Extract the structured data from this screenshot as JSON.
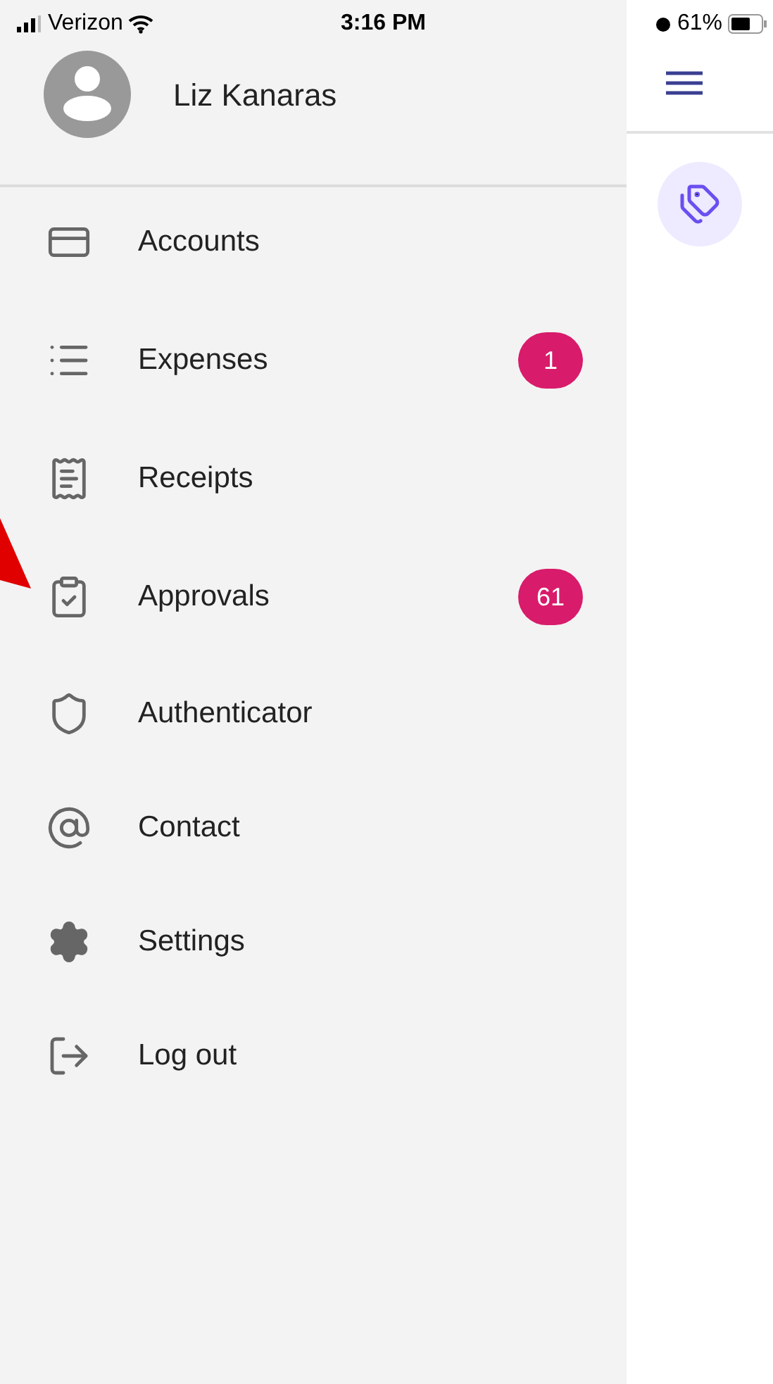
{
  "status_bar": {
    "carrier": "Verizon",
    "time": "3:16 PM",
    "battery": "61%"
  },
  "user": {
    "name": "Liz Kanaras"
  },
  "menu": [
    {
      "label": "Accounts"
    },
    {
      "label": "Expenses",
      "badge": "1"
    },
    {
      "label": "Receipts"
    },
    {
      "label": "Approvals",
      "badge": "61"
    },
    {
      "label": "Authenticator"
    },
    {
      "label": "Contact"
    },
    {
      "label": "Settings"
    },
    {
      "label": "Log out"
    }
  ]
}
